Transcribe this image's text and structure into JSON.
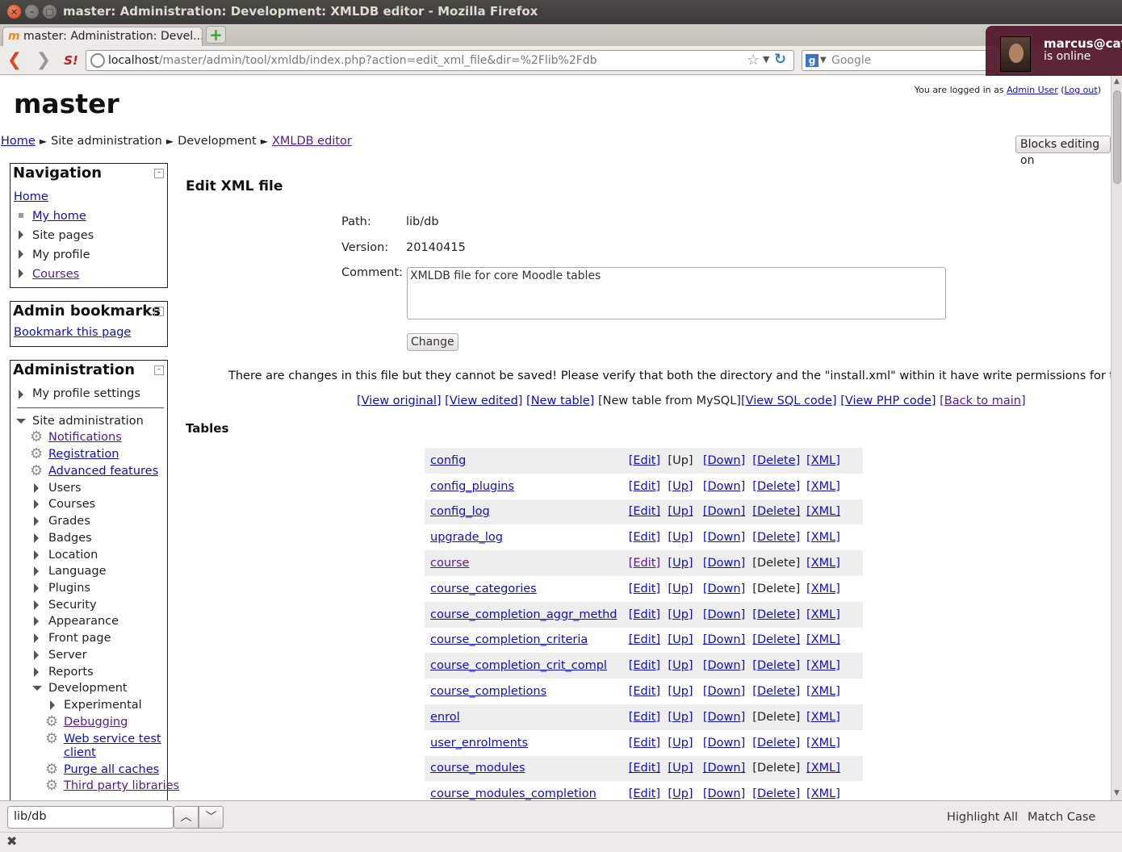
{
  "window": {
    "title": "master: Administration: Development: XMLDB editor - Mozilla Firefox"
  },
  "browser": {
    "tab_title": "master: Administration: Devel...",
    "url_host": "localhost",
    "url_path": "/master/admin/tool/xmldb/index.php?action=edit_xml_file&dir=%2Flib%2Fdb",
    "search_placeholder": "Google"
  },
  "notification": {
    "name": "marcus@catal",
    "status": "is online"
  },
  "header": {
    "site_name": "master",
    "login_prefix": "You are logged in as ",
    "login_user": "Admin User",
    "logout": "Log out",
    "blocks_editing": "Blocks editing on"
  },
  "breadcrumb": {
    "home": "Home",
    "site_admin": "Site administration",
    "development": "Development",
    "xmldb": "XMLDB editor",
    "sep": "►"
  },
  "navigation": {
    "title": "Navigation",
    "home": "Home",
    "my_home": "My home",
    "site_pages": "Site pages",
    "my_profile": "My profile",
    "courses": "Courses"
  },
  "admin_bookmarks": {
    "title": "Admin bookmarks",
    "bookmark": "Bookmark this page"
  },
  "administration": {
    "title": "Administration",
    "my_profile_settings": "My profile settings",
    "site_admin": "Site administration",
    "notifications": "Notifications",
    "registration": "Registration",
    "advanced_features": "Advanced features",
    "users": "Users",
    "courses": "Courses",
    "grades": "Grades",
    "badges": "Badges",
    "location": "Location",
    "language": "Language",
    "plugins": "Plugins",
    "security": "Security",
    "appearance": "Appearance",
    "front_page": "Front page",
    "server": "Server",
    "reports": "Reports",
    "development": "Development",
    "experimental": "Experimental",
    "debugging": "Debugging",
    "web_service_test_1": "Web service test",
    "web_service_test_2": "client",
    "purge_caches": "Purge all caches",
    "third_party": "Third party libraries"
  },
  "main": {
    "heading": "Edit XML file",
    "path_label": "Path:",
    "path_value": "lib/db",
    "version_label": "Version:",
    "version_value": "20140415",
    "comment_label": "Comment:",
    "comment_value": "XMLDB file for core Moodle tables",
    "change_button": "Change",
    "warning": "There are changes in this file but they cannot be saved! Please verify that both the directory and the \"install.xml\" within it have write permissions for the web server.",
    "actions": {
      "view_original": "[View original]",
      "view_edited": "[View edited]",
      "new_table": "[New table]",
      "new_table_mysql": "[New table from MySQL]",
      "view_sql": "[View SQL code]",
      "view_php": "[View PHP code]",
      "back_to_main": "[Back to main]"
    },
    "tables_heading": "Tables",
    "tables": [
      {
        "name": "config",
        "edit": "[Edit]",
        "up": "[Up]",
        "down": "[Down]",
        "delete": "[Delete]",
        "xml": "[XML]"
      },
      {
        "name": "config_plugins",
        "edit": "[Edit]",
        "up": "[Up]",
        "down": "[Down]",
        "delete": "[Delete]",
        "xml": "[XML]"
      },
      {
        "name": "config_log",
        "edit": "[Edit]",
        "up": "[Up]",
        "down": "[Down]",
        "delete": "[Delete]",
        "xml": "[XML]"
      },
      {
        "name": "upgrade_log",
        "edit": "[Edit]",
        "up": "[Up]",
        "down": "[Down]",
        "delete": "[Delete]",
        "xml": "[XML]"
      },
      {
        "name": "course",
        "edit": "[Edit]",
        "up": "[Up]",
        "down": "[Down]",
        "delete": "[Delete]",
        "xml": "[XML]"
      },
      {
        "name": "course_categories",
        "edit": "[Edit]",
        "up": "[Up]",
        "down": "[Down]",
        "delete": "[Delete]",
        "xml": "[XML]"
      },
      {
        "name": "course_completion_aggr_methd",
        "edit": "[Edit]",
        "up": "[Up]",
        "down": "[Down]",
        "delete": "[Delete]",
        "xml": "[XML]"
      },
      {
        "name": "course_completion_criteria",
        "edit": "[Edit]",
        "up": "[Up]",
        "down": "[Down]",
        "delete": "[Delete]",
        "xml": "[XML]"
      },
      {
        "name": "course_completion_crit_compl",
        "edit": "[Edit]",
        "up": "[Up]",
        "down": "[Down]",
        "delete": "[Delete]",
        "xml": "[XML]"
      },
      {
        "name": "course_completions",
        "edit": "[Edit]",
        "up": "[Up]",
        "down": "[Down]",
        "delete": "[Delete]",
        "xml": "[XML]"
      },
      {
        "name": "enrol",
        "edit": "[Edit]",
        "up": "[Up]",
        "down": "[Down]",
        "delete": "[Delete]",
        "xml": "[XML]"
      },
      {
        "name": "user_enrolments",
        "edit": "[Edit]",
        "up": "[Up]",
        "down": "[Down]",
        "delete": "[Delete]",
        "xml": "[XML]"
      },
      {
        "name": "course_modules",
        "edit": "[Edit]",
        "up": "[Up]",
        "down": "[Down]",
        "delete": "[Delete]",
        "xml": "[XML]"
      },
      {
        "name": "course_modules_completion",
        "edit": "[Edit]",
        "up": "[Up]",
        "down": "[Down]",
        "delete": "[Delete]",
        "xml": "[XML]"
      }
    ]
  },
  "findbar": {
    "value": "lib/db",
    "highlight_all": "Highlight All",
    "match_case": "Match Case"
  },
  "colors": {
    "link": "#0f0fbf",
    "visited": "#551a8b",
    "row_alt": "#eeeeee"
  }
}
